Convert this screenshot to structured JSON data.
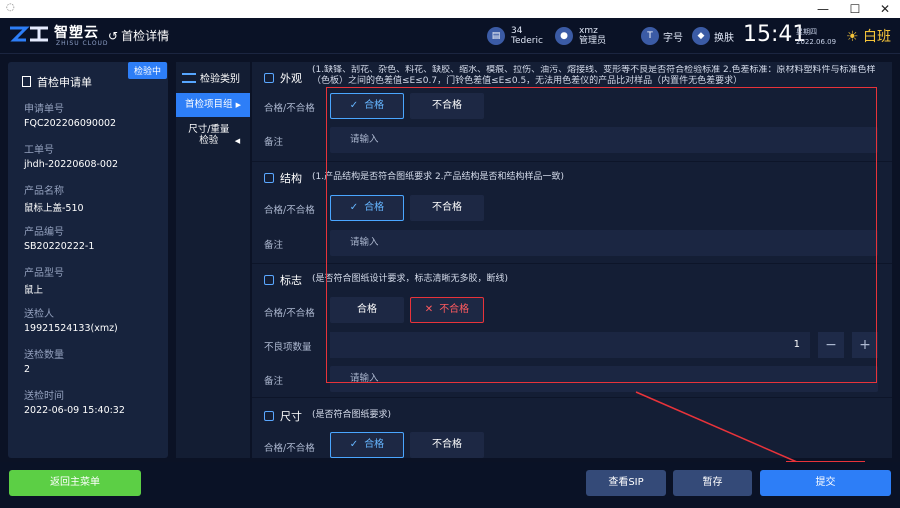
{
  "window": {
    "icon": "app-icon",
    "min": "—",
    "max": "☐",
    "close": "✕"
  },
  "header": {
    "brand": "智塑云",
    "brand_sub": "ZHISU CLOUD",
    "back_label": "首检详情",
    "shift_count": "34",
    "shift_user": "Tederic",
    "user_name": "xmz",
    "user_role": "管理员",
    "font_label": "字号",
    "skin_label": "换肤",
    "time": "15:41",
    "weekday": "星期四",
    "date": "2022.06.09",
    "shift": "白班"
  },
  "left": {
    "title": "首检申请单",
    "badge": "检验中",
    "fields": [
      {
        "label": "申请单号",
        "value": "FQC202206090002"
      },
      {
        "label": "工单号",
        "value": "jhdh-20220608-002"
      },
      {
        "label": "产品名称",
        "value": "鼠标上盖-510"
      },
      {
        "label": "产品编号",
        "value": "SB20220222-1"
      },
      {
        "label": "产品型号",
        "value": "鼠上"
      },
      {
        "label": "送检人",
        "value": "19921524133(xmz)"
      },
      {
        "label": "送检数量",
        "value": "2"
      },
      {
        "label": "送检时间",
        "value": "2022-06-09 15:40:32"
      }
    ]
  },
  "categories": {
    "header": "检验类别",
    "items": [
      {
        "label": "首检项目组"
      },
      {
        "label": "尺寸/重量检验"
      }
    ]
  },
  "form": {
    "labels": {
      "pass_fail": "合格/不合格",
      "remark": "备注",
      "defect_count": "不良项数量"
    },
    "pass": "合格",
    "fail": "不合格",
    "remark_placeholder": "请输入",
    "sections": [
      {
        "title": "外观",
        "desc": "(1.缺锋、刮花、杂色、料花、缺胶、缩水、模痕、拉伤、油污、熔接线、变形等不良是否符合检验标准 2.色差标准：原材料塑料件与标准色样（色板）之间的色差值≤E≤0.7，门铃色差值≤E≤0.5，无法用色差仪的产品比对样品（内置件无色差要求）",
        "selected": "pass"
      },
      {
        "title": "结构",
        "desc": "(1.产品结构是否符合图纸要求 2.产品结构是否和结构样品一致)",
        "selected": "pass"
      },
      {
        "title": "标志",
        "desc": "(是否符合图纸设计要求，标志清晰无多胶，断线)",
        "selected": "fail",
        "defect_count": "1"
      },
      {
        "title": "尺寸",
        "desc": "(是否符合图纸要求)",
        "selected": "pass"
      }
    ]
  },
  "bottom": {
    "main_menu": "返回主菜单",
    "view_sip": "查看SIP",
    "save": "暂存",
    "submit": "提交"
  },
  "colors": {
    "accent": "#2d7ef7",
    "pass": "#4aa6ff",
    "fail": "#e8333a",
    "green": "#5ccf45"
  }
}
